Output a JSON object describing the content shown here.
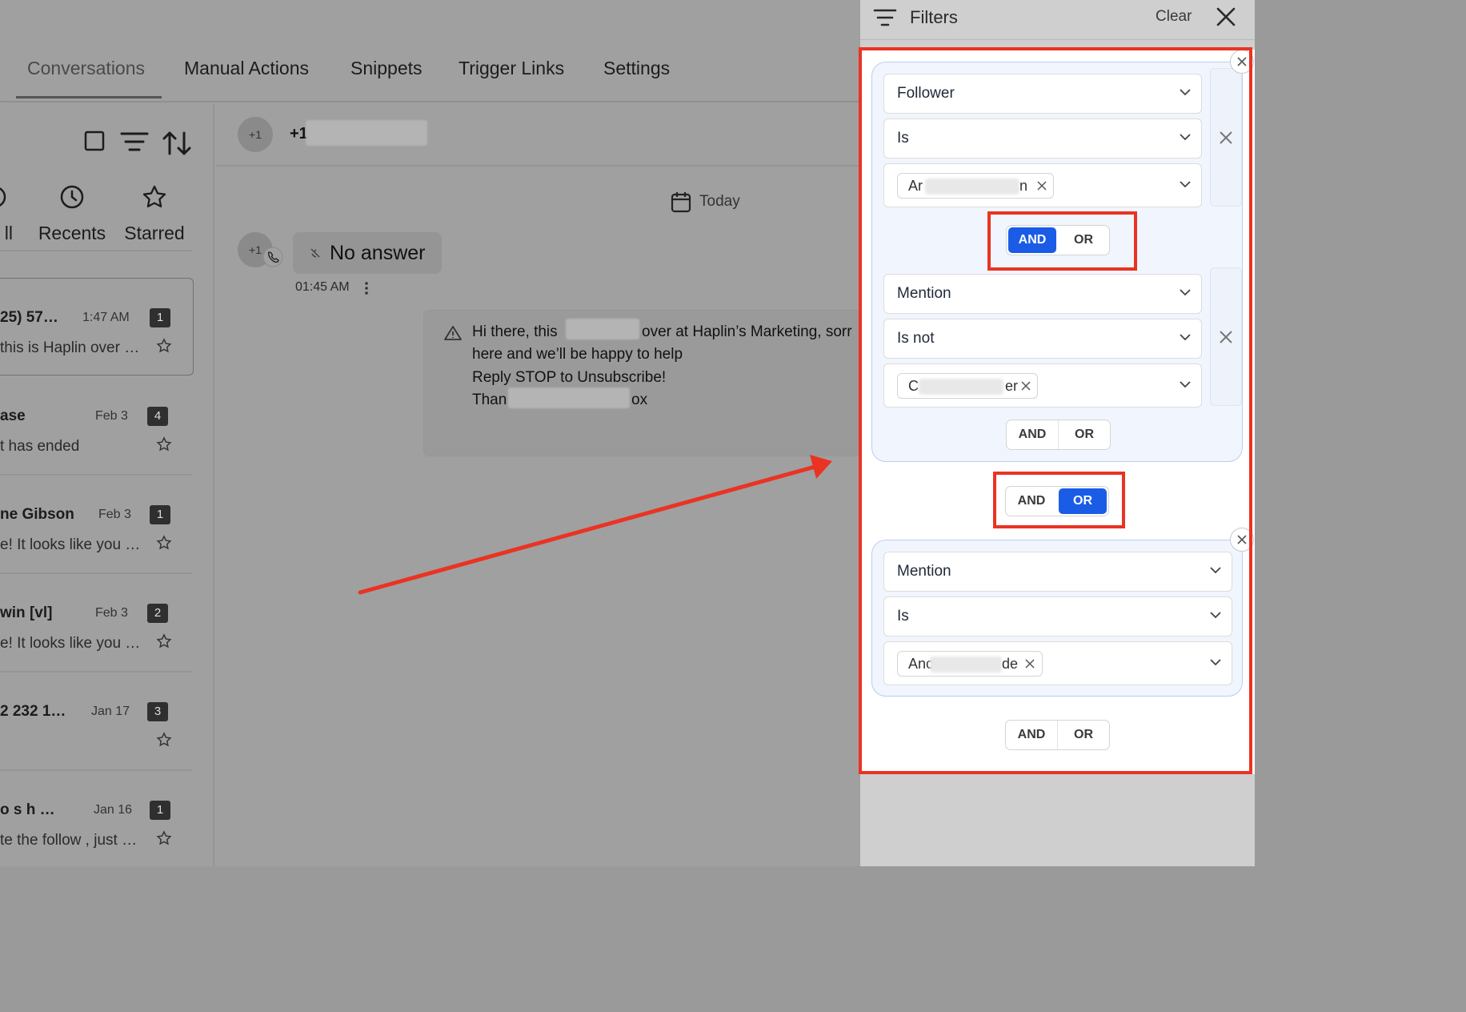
{
  "tabs": [
    {
      "label": "Conversations",
      "active": true
    },
    {
      "label": "Manual Actions",
      "active": false
    },
    {
      "label": "Snippets",
      "active": false
    },
    {
      "label": "Trigger Links",
      "active": false
    },
    {
      "label": "Settings",
      "active": false
    }
  ],
  "categories": [
    {
      "label": "ll",
      "icon": "all-icon"
    },
    {
      "label": "Recents",
      "icon": "clock-icon"
    },
    {
      "label": "Starred",
      "icon": "star-icon"
    }
  ],
  "conversations": [
    {
      "name": "25) 57…",
      "time": "1:47 AM",
      "badge": "1",
      "message": "this is Haplin over …",
      "selected": true
    },
    {
      "name": "ase",
      "time": "Feb 3",
      "badge": "4",
      "message": "t has ended",
      "selected": false
    },
    {
      "name": "ne Gibson",
      "time": "Feb 3",
      "badge": "1",
      "message": "e!  It looks like you …",
      "selected": false
    },
    {
      "name": "win [vl]",
      "time": "Feb 3",
      "badge": "2",
      "message": "e!  It looks like you …",
      "selected": false
    },
    {
      "name": "2 232 1…",
      "time": "Jan 17",
      "badge": "3",
      "message": "",
      "selected": false
    },
    {
      "name": "o s h …",
      "time": "Jan 16",
      "badge": "1",
      "message": "te the follow , just …",
      "selected": false
    }
  ],
  "chat": {
    "contact_avatar": "+1",
    "contact_prefix": "+1",
    "date_chip": "Today",
    "call_avatar": "+1",
    "call_status": "No answer",
    "call_time": "01:45 AM",
    "message_lines": [
      "Hi there, this",
      "over at Haplin’s Marketing, sorr",
      "here and we’ll be happy to help",
      "Reply STOP to Unsubscribe!",
      "Than",
      "ox"
    ]
  },
  "filters": {
    "title": "Filters",
    "clear_label": "Clear",
    "groups": [
      {
        "rules": [
          {
            "field": "Follower",
            "operator": "Is",
            "chip_start": "Ar",
            "chip_end": "n"
          },
          {
            "field": "Mention",
            "operator": "Is not",
            "chip_start": "C",
            "chip_end": "er"
          }
        ],
        "connector": {
          "and": "AND",
          "or": "OR",
          "selected": "AND"
        },
        "trailing": {
          "and": "AND",
          "or": "OR"
        }
      },
      {
        "rules": [
          {
            "field": "Mention",
            "operator": "Is",
            "chip_start": "Anc",
            "chip_end": "de"
          }
        ]
      }
    ],
    "group_connector": {
      "and": "AND",
      "or": "OR",
      "selected": "OR"
    },
    "bottom_connector": {
      "and": "AND",
      "or": "OR"
    }
  },
  "colors": {
    "accent": "#1a5ce6",
    "annotation": "#ea3323",
    "group_bg": "#f1f5fe"
  }
}
